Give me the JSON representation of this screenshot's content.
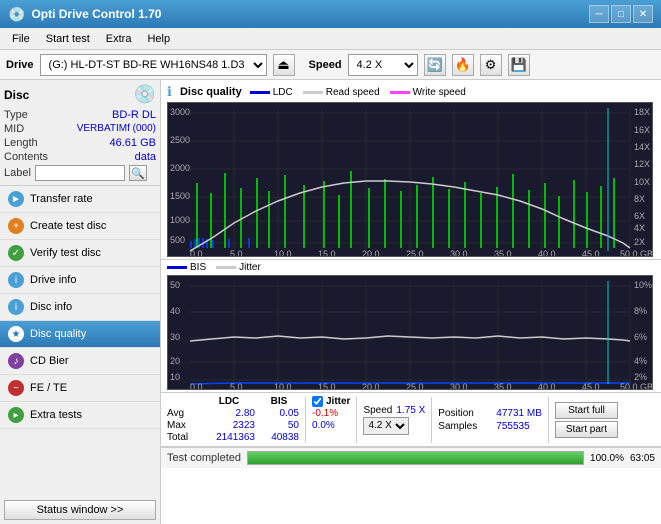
{
  "titleBar": {
    "title": "Opti Drive Control 1.70",
    "minimizeLabel": "─",
    "maximizeLabel": "□",
    "closeLabel": "✕"
  },
  "menuBar": {
    "items": [
      "File",
      "Start test",
      "Extra",
      "Help"
    ]
  },
  "driveBar": {
    "driveLabel": "Drive",
    "driveValue": "(G:)  HL-DT-ST BD-RE  WH16NS48 1.D3",
    "speedLabel": "Speed",
    "speedValue": "4.2 X"
  },
  "disc": {
    "title": "Disc",
    "typeLabel": "Type",
    "typeValue": "BD-R DL",
    "midLabel": "MID",
    "midValue": "VERBATIMf (000)",
    "lengthLabel": "Length",
    "lengthValue": "46.61 GB",
    "contentsLabel": "Contents",
    "contentsValue": "data",
    "labelLabel": "Label"
  },
  "nav": {
    "items": [
      {
        "id": "transfer-rate",
        "label": "Transfer rate",
        "icon": "►"
      },
      {
        "id": "create-test",
        "label": "Create test disc",
        "icon": "◉"
      },
      {
        "id": "verify-test",
        "label": "Verify test disc",
        "icon": "✓"
      },
      {
        "id": "drive-info",
        "label": "Drive info",
        "icon": "i"
      },
      {
        "id": "disc-info",
        "label": "Disc info",
        "icon": "i"
      },
      {
        "id": "disc-quality",
        "label": "Disc quality",
        "icon": "★",
        "active": true
      },
      {
        "id": "cd-bier",
        "label": "CD Bier",
        "icon": "♪"
      },
      {
        "id": "fe-te",
        "label": "FE / TE",
        "icon": "~"
      },
      {
        "id": "extra-tests",
        "label": "Extra tests",
        "icon": "▸"
      }
    ],
    "statusBtn": "Status window >>"
  },
  "charts": {
    "title": "Disc quality",
    "legend1": [
      {
        "label": "LDC",
        "color": "#0000aa"
      },
      {
        "label": "Read speed",
        "color": "#ffffff"
      },
      {
        "label": "Write speed",
        "color": "#ff00ff"
      }
    ],
    "legend2": [
      {
        "label": "BIS",
        "color": "#0000aa"
      },
      {
        "label": "Jitter",
        "color": "#ffffff"
      }
    ]
  },
  "statsTable": {
    "headers": [
      "",
      "LDC",
      "BIS",
      "",
      "Jitter",
      "Speed",
      "",
      ""
    ],
    "avgLabel": "Avg",
    "avgLDC": "2.80",
    "avgBIS": "0.05",
    "avgJitter": "-0.1%",
    "maxLabel": "Max",
    "maxLDC": "2323",
    "maxBIS": "50",
    "maxJitter": "0.0%",
    "totalLabel": "Total",
    "totalLDC": "2141363",
    "totalBIS": "40838",
    "speedLabel": "Speed",
    "speedValue": "1.75 X",
    "speedSelect": "4.2 X",
    "positionLabel": "Position",
    "positionValue": "47731 MB",
    "samplesLabel": "Samples",
    "samplesValue": "755535"
  },
  "progress": {
    "statusText": "Test completed",
    "progressValue": "100.0%",
    "timeValue": "63:05",
    "startFullLabel": "Start full",
    "startPartLabel": "Start part"
  }
}
